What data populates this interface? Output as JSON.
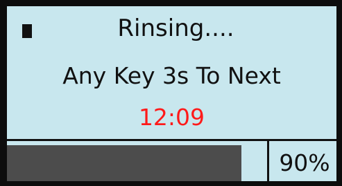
{
  "screen": {
    "status_text": "Rinsing....",
    "cursor_icon": "cursor-block-icon",
    "prompt_text": "Any Key 3s To Next",
    "timer_text": "12:09",
    "progress_percent": 90,
    "progress_label": "90%"
  },
  "colors": {
    "background": "#c8e7ee",
    "text": "#111111",
    "timer": "#ff1a1a",
    "progress_fill": "#4c4c4c",
    "frame": "#0d0d0d"
  }
}
